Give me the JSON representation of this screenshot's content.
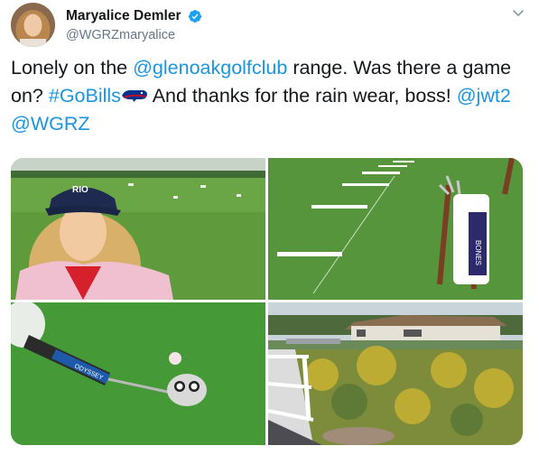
{
  "tweet": {
    "author": {
      "display_name": "Maryalice Demler",
      "handle": "@WGRZmaryalice",
      "verified": true
    },
    "text_parts": [
      {
        "type": "text",
        "value": "Lonely on the "
      },
      {
        "type": "link",
        "value": "@glenoakgolfclub"
      },
      {
        "type": "text",
        "value": " range.  Was there a game on? "
      },
      {
        "type": "link",
        "value": "#GoBills"
      },
      {
        "type": "icon",
        "value": "buffalo-bills-emoji"
      },
      {
        "type": "text",
        "value": "  And thanks for the rain wear, boss! "
      },
      {
        "type": "link",
        "value": "@jwt2"
      },
      {
        "type": "text",
        "value": " "
      },
      {
        "type": "link",
        "value": "@WGRZ"
      }
    ],
    "photos": {
      "photo1": {
        "cap_text": "RIO"
      },
      "photo2": {
        "bag_text": "BONES"
      },
      "photo3": {
        "grip_text": "ODYSSEY"
      },
      "photo4": {}
    }
  },
  "icons": {
    "verified": "verified-badge-icon",
    "menu": "chevron-down-icon",
    "team": "buffalo-bills-emoji"
  },
  "colors": {
    "link": "#1b95e0",
    "verified": "#1da1f2",
    "secondary_text": "#657786"
  }
}
